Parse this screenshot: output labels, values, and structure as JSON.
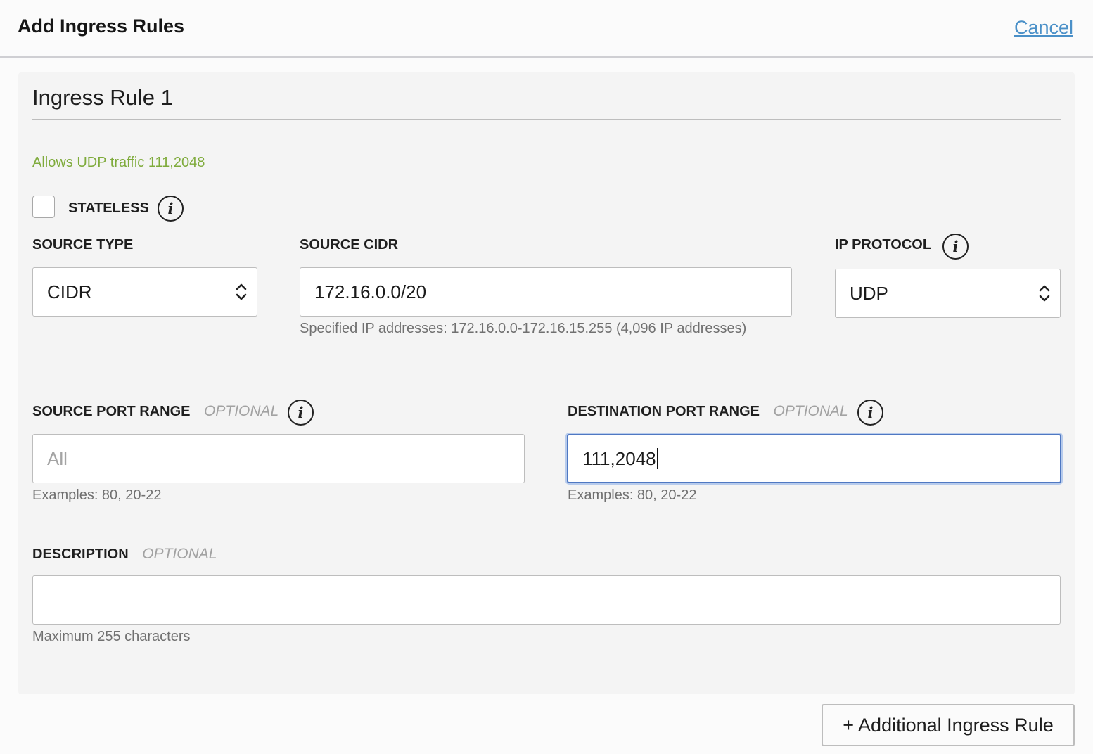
{
  "header": {
    "title": "Add Ingress Rules",
    "cancel_label": "Cancel"
  },
  "rule": {
    "title": "Ingress Rule 1",
    "summary": "Allows UDP traffic 111,2048",
    "stateless": {
      "label": "STATELESS",
      "checked": false
    },
    "source_type": {
      "label": "SOURCE TYPE",
      "value": "CIDR"
    },
    "source_cidr": {
      "label": "SOURCE CIDR",
      "value": "172.16.0.0/20",
      "help": "Specified IP addresses: 172.16.0.0-172.16.15.255 (4,096 IP addresses)"
    },
    "ip_protocol": {
      "label": "IP PROTOCOL",
      "value": "UDP"
    },
    "source_port_range": {
      "label": "SOURCE PORT RANGE",
      "optional": "OPTIONAL",
      "placeholder": "All",
      "help": "Examples: 80, 20-22"
    },
    "destination_port_range": {
      "label": "DESTINATION PORT RANGE",
      "optional": "OPTIONAL",
      "value": "111,2048",
      "help": "Examples: 80, 20-22"
    },
    "description": {
      "label": "DESCRIPTION",
      "optional": "OPTIONAL",
      "value": "",
      "help": "Maximum 255 characters"
    }
  },
  "additional_rule_button": "+ Additional Ingress Rule",
  "icons": {
    "info": "info-icon",
    "select": "chevron-updown-icon"
  },
  "colors": {
    "summary": "#7fab3c",
    "link": "#4a90c8",
    "focus": "#4f78c2"
  }
}
